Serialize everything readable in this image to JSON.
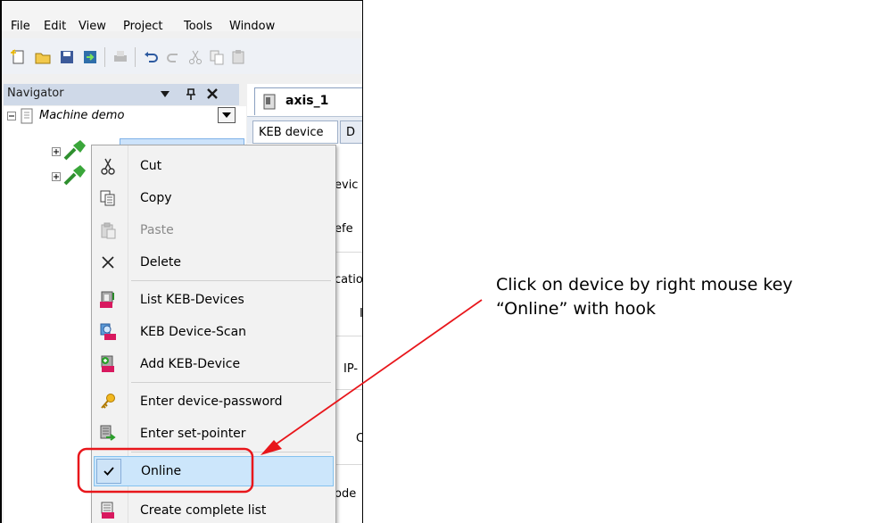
{
  "menubar": {
    "items": [
      "File",
      "Edit",
      "View",
      "Project",
      "Tools",
      "Window"
    ]
  },
  "navigator": {
    "title": "Navigator",
    "header_icons": [
      "dropdown-arrow-icon",
      "pin-icon",
      "close-icon"
    ],
    "tree_root": "Machine demo"
  },
  "editor": {
    "doc_tab": "axis_1",
    "sub_tab_active": "KEB device",
    "sub_tab_partial": "D",
    "fragments": [
      "evic",
      "efe",
      "catio",
      "I",
      "IP-",
      "C",
      "ode"
    ]
  },
  "context_menu": {
    "items": [
      {
        "label": "Cut",
        "icon": "scissors-icon",
        "disabled": false
      },
      {
        "label": "Copy",
        "icon": "copy-icon",
        "disabled": false
      },
      {
        "label": "Paste",
        "icon": "paste-icon",
        "disabled": true
      },
      {
        "label": "Delete",
        "icon": "delete-x-icon",
        "disabled": false
      },
      {
        "label": "List KEB-Devices",
        "icon": "keb-list-icon",
        "disabled": false
      },
      {
        "label": "KEB Device-Scan",
        "icon": "keb-scan-icon",
        "disabled": false
      },
      {
        "label": "Add KEB-Device",
        "icon": "keb-add-icon",
        "disabled": false
      },
      {
        "label": "Enter device-password",
        "icon": "key-icon",
        "disabled": false
      },
      {
        "label": "Enter set-pointer",
        "icon": "set-pointer-icon",
        "disabled": false
      },
      {
        "label": "Online",
        "icon": "checkmark-icon",
        "checked": true,
        "disabled": false
      },
      {
        "label": "Create complete list",
        "icon": "keb-complete-list-icon",
        "disabled": false
      }
    ]
  },
  "annotation": {
    "line1": "Click on device by right mouse key",
    "line2": "“Online” with hook",
    "color": "#e8161b"
  }
}
